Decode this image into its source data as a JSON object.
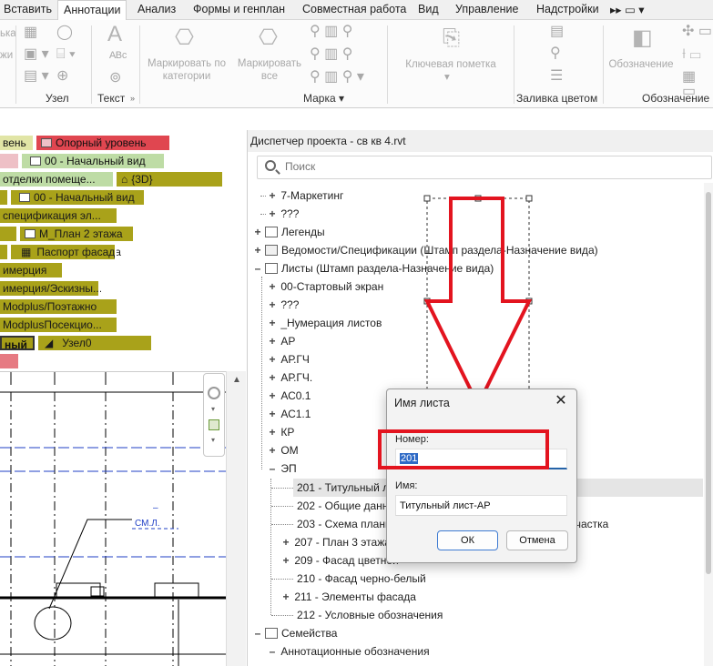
{
  "ribbon": {
    "tabs": [
      {
        "label": "Вставить",
        "active": false
      },
      {
        "label": "Аннотации",
        "active": true
      },
      {
        "label": "Анализ",
        "active": false
      },
      {
        "label": "Формы и генплан",
        "active": false
      },
      {
        "label": "Совместная работа",
        "active": false
      },
      {
        "label": "Вид",
        "active": false
      },
      {
        "label": "Управление",
        "active": false
      },
      {
        "label": "Надстройки",
        "active": false
      }
    ],
    "overflow_label": "▸▸ ▭ ▾",
    "left_cut_1": "ька",
    "left_cut_2": "жи",
    "tag_by_category": "Маркировать по\nкатегории",
    "tag_all": "Маркировать\nвсе",
    "keynote": "Ключевая пометка",
    "legend_label": "Обозначение",
    "groups": {
      "detail": "Узел",
      "text": "Текст",
      "tag": "Марка",
      "color_fill": "Заливка цветом",
      "symbol": "Обозначение"
    },
    "dialog_launcher": "»",
    "dropdown_arrow": "▾"
  },
  "canvas": {
    "tags": [
      {
        "text": "вень",
        "style": "t-yel"
      },
      {
        "text": "Опорный уровень",
        "style": "t-red"
      },
      {
        "text": "00 - Начальный вид",
        "style": "t-green"
      },
      {
        "text": "отделки помеще...",
        "style": "t-green"
      },
      {
        "text": "{3D}",
        "style": "t-olive"
      },
      {
        "text": "00 - Начальный вид",
        "style": "t-olive"
      },
      {
        "text": "спецификация эл...",
        "style": "t-olive"
      },
      {
        "text": "М_План 2 этажа",
        "style": "t-olive"
      },
      {
        "text": "Паспорт фасада",
        "style": "t-olive"
      },
      {
        "text": "имерция",
        "style": "t-olive"
      },
      {
        "text": "имерция/Эскизны...",
        "style": "t-olive"
      },
      {
        "text": "Modplus/Поэтажно",
        "style": "t-olive"
      },
      {
        "text": "ModplusПосекцио...",
        "style": "t-olive"
      },
      {
        "text": "ный",
        "style": "t-dark"
      },
      {
        "text": "Узел0",
        "style": "t-olive"
      }
    ],
    "drawing_label": "СМ.Л.",
    "drawing_dash": "–"
  },
  "browser": {
    "title": "Диспетчер проекта - св кв 4.rvt",
    "search_placeholder": "Поиск",
    "rows": [
      {
        "text": "7-Маркетинг",
        "exp": "+"
      },
      {
        "text": "???",
        "exp": "+"
      },
      {
        "text": "Легенды",
        "exp": "+"
      },
      {
        "text": "Ведомости/Спецификации (Штамп раздела-Назначение вида)",
        "exp": "+"
      },
      {
        "text": "Листы (Штамп раздела-Назначение вида)",
        "exp": "–"
      },
      {
        "text": "00-Стартовый экран",
        "exp": "+"
      },
      {
        "text": "???",
        "exp": "+"
      },
      {
        "text": "_Нумерация листов",
        "exp": "+"
      },
      {
        "text": "АР",
        "exp": "+"
      },
      {
        "text": "АР.ГЧ",
        "exp": "+"
      },
      {
        "text": "АР.ГЧ.",
        "exp": "+"
      },
      {
        "text": "АС0.1",
        "exp": "+"
      },
      {
        "text": "АС1.1",
        "exp": "+"
      },
      {
        "text": "КР",
        "exp": "+"
      },
      {
        "text": "ОМ",
        "exp": "+"
      },
      {
        "text": "ЭП",
        "exp": "–"
      },
      {
        "text": "201 - Титульный лист-АР",
        "exp": ""
      },
      {
        "text": "202 - Общие данные",
        "exp": ""
      },
      {
        "text": "203 - Схема планировочной организации земельного участка",
        "exp": ""
      },
      {
        "text": "207 - План 3 этажа",
        "exp": "+"
      },
      {
        "text": "209 - Фасад цветной",
        "exp": "+"
      },
      {
        "text": "210 - Фасад черно-белый",
        "exp": ""
      },
      {
        "text": "211 - Элементы фасада",
        "exp": "+"
      },
      {
        "text": "212 - Условные обозначения",
        "exp": ""
      },
      {
        "text": "Семейства",
        "exp": "–"
      },
      {
        "text": "Аннотационные обозначения",
        "exp": "–"
      }
    ]
  },
  "dialog": {
    "title": "Имя листа",
    "close_glyph": "✕",
    "number_label": "Номер:",
    "number_value": "201",
    "name_label": "Имя:",
    "name_value": "Титульный лист-АР",
    "ok_label": "ОК",
    "cancel_label": "Отмена"
  },
  "colors": {
    "annotation_red": "#e3141f",
    "selection_blue": "#2e6ac6",
    "tag_olive": "#a9a21a"
  }
}
